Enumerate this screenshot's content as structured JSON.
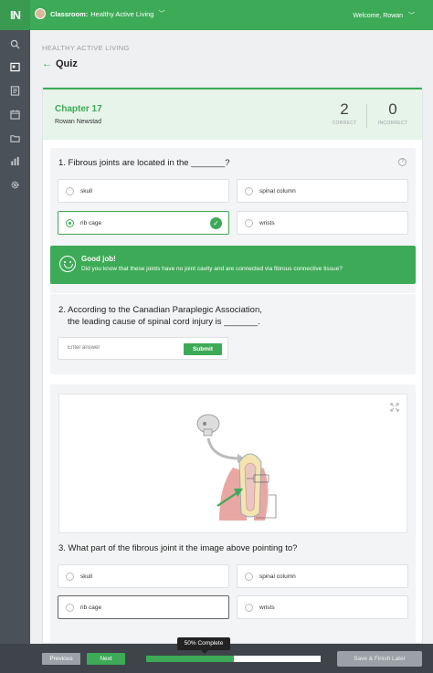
{
  "topbar": {
    "logo": "IN",
    "classroom_label": "Classroom:",
    "classroom_name": "Healthy Active Living",
    "welcome": "Welcome, Rowan"
  },
  "rail": {
    "icons": [
      "search-icon",
      "dashboard-icon",
      "document-icon",
      "calendar-icon",
      "folder-icon",
      "chart-icon",
      "gear-icon"
    ]
  },
  "header": {
    "section": "HEALTHY ACTIVE LIVING",
    "title": "Quiz"
  },
  "chapter": {
    "title": "Chapter 17",
    "student": "Rowan Newstad",
    "correct_count": "2",
    "correct_label": "CORRECT",
    "incorrect_count": "0",
    "incorrect_label": "INCORRECT"
  },
  "q1": {
    "text": "1. Fibrous joints are located in the _______?",
    "options": [
      "skull",
      "spinal column",
      "rib cage",
      "wrists"
    ],
    "selected": "rib cage",
    "feedback_title": "Good job!",
    "feedback_text": "Did you know that these joints have no joint cavity and are connected via fibrous connective tissue?"
  },
  "q2": {
    "text_line1": "2. According to the Canadian Paraplegic Association,",
    "text_line2": "the leading cause of spinal cord injury is _______.",
    "placeholder": "Enter answer",
    "submit": "Submit"
  },
  "q3": {
    "text": "3. What part of the fibrous joint it the image above pointing to?",
    "options": [
      "skull",
      "spinal column",
      "rib cage",
      "wrists"
    ]
  },
  "bottom": {
    "previous": "Previous",
    "next": "Next",
    "progress_label": "50% Complete",
    "progress_fraction": 0.5,
    "save": "Save & Finish Later"
  },
  "colors": {
    "accent": "#3daa57",
    "rail": "#4a5158",
    "bottombar": "#3e4449"
  }
}
